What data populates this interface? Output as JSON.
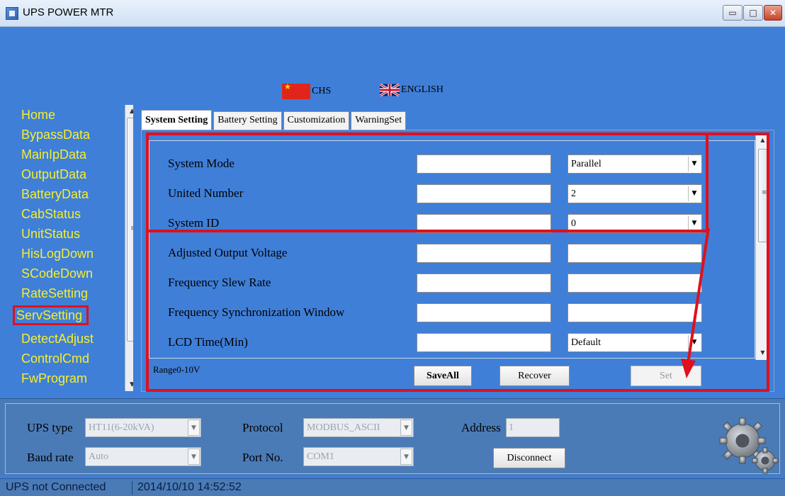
{
  "window": {
    "title": "UPS POWER MTR",
    "minimize_glyph": "▭",
    "maximize_glyph": "□",
    "close_glyph": "✕"
  },
  "languages": [
    {
      "label": "CHS",
      "icon": "china-flag-icon"
    },
    {
      "label": "ENGLISH",
      "icon": "uk-flag-icon"
    }
  ],
  "sidebar": {
    "items": [
      {
        "label": "Home"
      },
      {
        "label": "BypassData"
      },
      {
        "label": "MainIpData"
      },
      {
        "label": "OutputData"
      },
      {
        "label": "BatteryData"
      },
      {
        "label": "CabStatus"
      },
      {
        "label": "UnitStatus"
      },
      {
        "label": "HisLogDown"
      },
      {
        "label": "SCodeDown"
      },
      {
        "label": "RateSetting"
      },
      {
        "label": "ServSetting",
        "active": true
      },
      {
        "label": "DetectAdjust"
      },
      {
        "label": "ControlCmd"
      },
      {
        "label": "FwProgram"
      }
    ],
    "scroll_up": "▲",
    "scroll_down": "▼",
    "grip": "≡"
  },
  "tabs": [
    {
      "label": "System Setting",
      "active": true
    },
    {
      "label": "Battery Setting"
    },
    {
      "label": "Customization"
    },
    {
      "label": "WarningSet"
    }
  ],
  "settings": {
    "rows": [
      {
        "label": "System Mode",
        "value": "",
        "setting": "Parallel",
        "setting_is_select": true
      },
      {
        "label": "United Number",
        "value": "",
        "setting": "2",
        "setting_is_select": true
      },
      {
        "label": "System ID",
        "value": "",
        "setting": "0",
        "setting_is_select": true
      },
      {
        "label": "Adjusted Output Voltage",
        "value": "",
        "setting": "",
        "setting_is_select": false
      },
      {
        "label": "Frequency Slew Rate",
        "value": "",
        "setting": "",
        "setting_is_select": false
      },
      {
        "label": "Frequency Synchronization Window",
        "value": "",
        "setting": "",
        "setting_is_select": false
      },
      {
        "label": "LCD Time(Min)",
        "value": "",
        "setting": "Default",
        "setting_is_select": true
      }
    ],
    "range_text": "Range0-10V",
    "save_all_label": "SaveAll",
    "recover_label": "Recover",
    "set_label": "Set",
    "dropdown_arrow": "▼",
    "scroll_up": "▲",
    "scroll_down": "▼",
    "grip": "≡"
  },
  "connection": {
    "ups_type_label": "UPS type",
    "ups_type_value": "HT11(6-20kVA)",
    "protocol_label": "Protocol",
    "protocol_value": "MODBUS_ASCII",
    "address_label": "Address",
    "address_value": "1",
    "baud_rate_label": "Baud rate",
    "baud_rate_value": "Auto",
    "port_label": "Port No.",
    "port_value": "COM1",
    "disconnect_label": "Disconnect",
    "dropdown_arrow": "▼"
  },
  "status": {
    "connection_text": "UPS not Connected",
    "timestamp": "2014/10/10 14:52:52"
  },
  "colors": {
    "background": "#3f7fd8",
    "nav_text": "#f7ee2b",
    "highlight": "#e0101c",
    "bottom_panel": "#4a7bb7"
  }
}
